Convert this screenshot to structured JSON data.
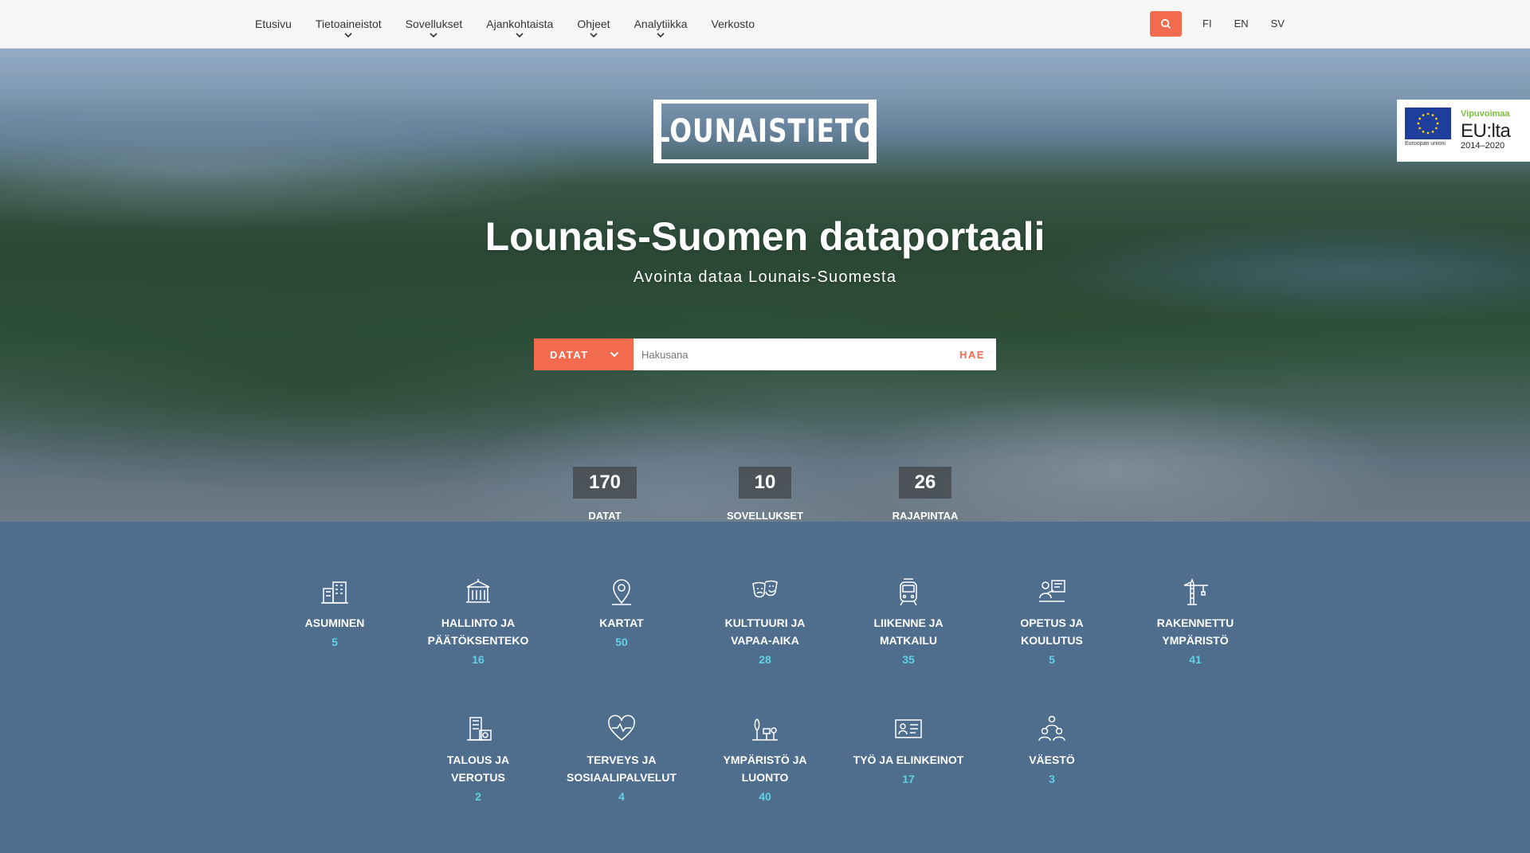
{
  "nav": {
    "items": [
      {
        "label": "Etusivu",
        "dropdown": false
      },
      {
        "label": "Tietoaineistot",
        "dropdown": true
      },
      {
        "label": "Sovellukset",
        "dropdown": true
      },
      {
        "label": "Ajankohtaista",
        "dropdown": true
      },
      {
        "label": "Ohjeet",
        "dropdown": true
      },
      {
        "label": "Analytiikka",
        "dropdown": true
      },
      {
        "label": "Verkosto",
        "dropdown": false
      }
    ],
    "languages": [
      "FI",
      "EN",
      "SV"
    ]
  },
  "colors": {
    "accent": "#f26b4f",
    "category_bg": "#4f6d8c",
    "count": "#5fd3e6"
  },
  "hero": {
    "logo": "LOUNAISTIETO",
    "title": "Lounais-Suomen dataportaali",
    "subtitle": "Avointa dataa Lounais-Suomesta",
    "eu": {
      "line1": "Vipuvoimaa",
      "line2": "EU:lta",
      "line3": "2014–2020",
      "small": "Euroopan unioni"
    }
  },
  "search": {
    "type_label": "DATAT",
    "placeholder": "Hakusana",
    "button": "HAE"
  },
  "stats": [
    {
      "value": "170",
      "label": "DATAT"
    },
    {
      "value": "10",
      "label": "SOVELLUKSET"
    },
    {
      "value": "26",
      "label": "RAJAPINTAA"
    }
  ],
  "categories": [
    {
      "name": "ASUMINEN",
      "count": "5",
      "icon": "building-icon"
    },
    {
      "name": "HALLINTO JA\nPÄÄTÖKSENTEKO",
      "count": "16",
      "icon": "government-icon"
    },
    {
      "name": "KARTAT",
      "count": "50",
      "icon": "map-pin-icon"
    },
    {
      "name": "KULTTUURI JA\nVAPAA-AIKA",
      "count": "28",
      "icon": "theater-masks-icon"
    },
    {
      "name": "LIIKENNE JA\nMATKAILU",
      "count": "35",
      "icon": "tram-icon"
    },
    {
      "name": "OPETUS JA\nKOULUTUS",
      "count": "5",
      "icon": "teacher-icon"
    },
    {
      "name": "RAKENNETTU\nYMPÄRISTÖ",
      "count": "41",
      "icon": "crane-icon"
    },
    {
      "name": "TALOUS JA\nVEROTUS",
      "count": "2",
      "icon": "finance-icon"
    },
    {
      "name": "TERVEYS JA\nSOSIAALIPALVELUT",
      "count": "4",
      "icon": "heart-pulse-icon"
    },
    {
      "name": "YMPÄRISTÖ JA\nLUONTO",
      "count": "40",
      "icon": "nature-icon"
    },
    {
      "name": "TYÖ JA ELINKEINOT",
      "count": "17",
      "icon": "id-card-icon"
    },
    {
      "name": "VÄESTÖ",
      "count": "3",
      "icon": "people-icon"
    }
  ]
}
